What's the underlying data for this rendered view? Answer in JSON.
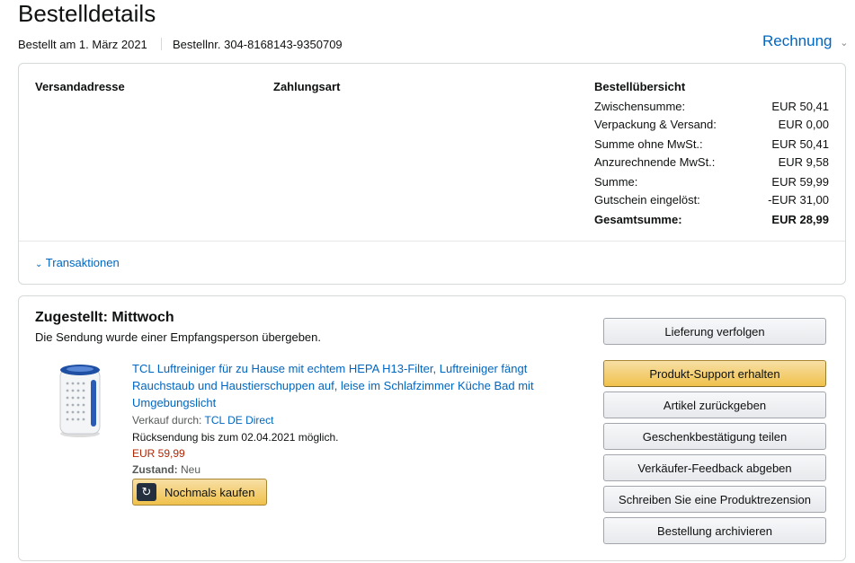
{
  "page": {
    "title": "Bestelldetails",
    "order_date": "Bestellt am 1. März 2021",
    "order_number": "Bestellnr. 304-8168143-9350709",
    "invoice_label": "Rechnung"
  },
  "summary_box": {
    "shipping_header": "Versandadresse",
    "payment_header": "Zahlungsart",
    "overview_header": "Bestellübersicht",
    "rows": [
      {
        "label": "Zwischensumme:",
        "value": "EUR 50,41"
      },
      {
        "label": "Verpackung & Versand:",
        "value": "EUR 0,00"
      },
      {
        "label": "Summe ohne MwSt.:",
        "value": "EUR 50,41"
      },
      {
        "label": "Anzurechnende MwSt.:",
        "value": "EUR 9,58"
      },
      {
        "label": "Summe:",
        "value": "EUR 59,99"
      },
      {
        "label": "Gutschein eingelöst:",
        "value": "-EUR 31,00"
      },
      {
        "label": "Gesamtsumme:",
        "value": "EUR 28,99"
      }
    ],
    "transactions_label": "Transaktionen"
  },
  "shipment": {
    "status": "Zugestellt: Mittwoch",
    "status_detail": "Die Sendung wurde einer Empfangsperson übergeben.",
    "product": {
      "title": "TCL Luftreiniger für zu Hause mit echtem HEPA H13-Filter, Luftreiniger fängt Rauchstaub und Haustierschuppen auf, leise im Schlafzimmer Küche Bad mit Umgebungslicht",
      "sold_by_label": "Verkauf durch:",
      "seller": "TCL DE Direct",
      "return_info": "Rücksendung bis zum 02.04.2021 möglich.",
      "price": "EUR 59,99",
      "condition_label": "Zustand:",
      "condition": "Neu",
      "buy_again_label": "Nochmals kaufen"
    },
    "actions": [
      "Lieferung verfolgen",
      "Produkt-Support erhalten",
      "Artikel zurückgeben",
      "Geschenkbestätigung teilen",
      "Verkäufer-Feedback abgeben",
      "Schreiben Sie eine Produktrezension",
      "Bestellung archivieren"
    ]
  },
  "colors": {
    "link": "#0066c0",
    "price": "#b12704",
    "primary_button": "#f0c14b"
  }
}
